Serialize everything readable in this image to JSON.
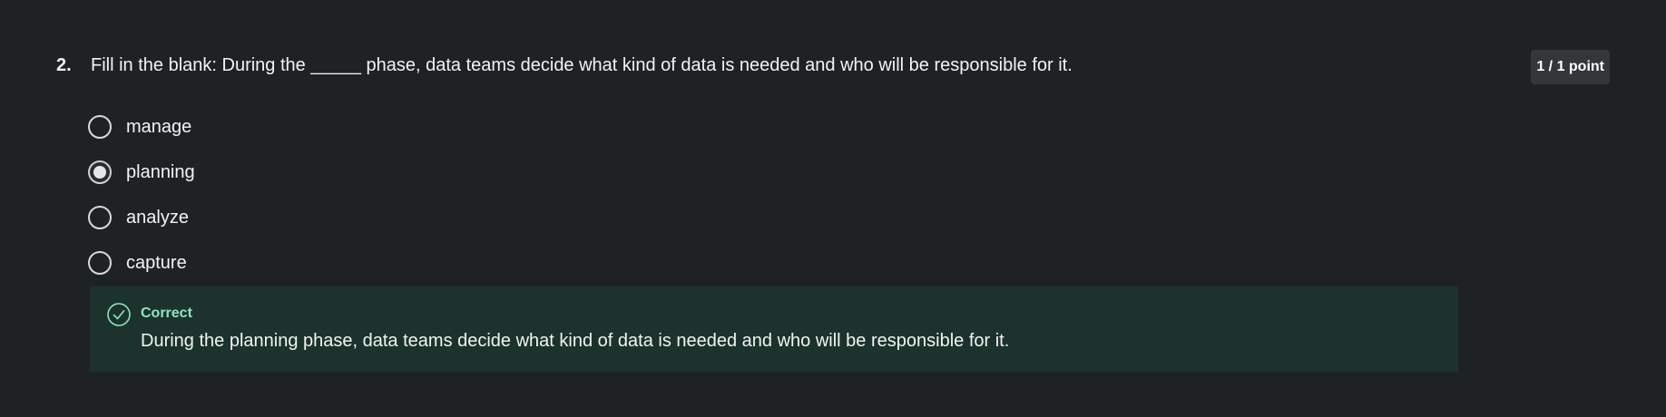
{
  "question": {
    "number": "2.",
    "text": "Fill in the blank: During the _____ phase, data teams decide what kind of data is needed and who will be responsible for it.",
    "points": "1 / 1 point",
    "options": [
      {
        "label": "manage",
        "selected": false
      },
      {
        "label": "planning",
        "selected": true
      },
      {
        "label": "analyze",
        "selected": false
      },
      {
        "label": "capture",
        "selected": false
      }
    ]
  },
  "feedback": {
    "status": "Correct",
    "icon": "check-circle-icon",
    "message": "During the planning phase, data teams decide what kind of data is needed and who will be responsible for it.",
    "accent_color": "#8fe3c3",
    "background_color": "#1b332c"
  }
}
